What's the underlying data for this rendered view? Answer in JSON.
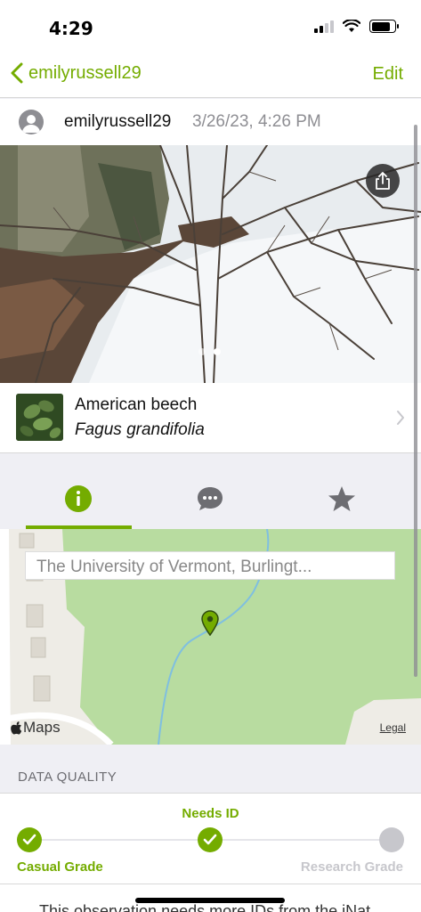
{
  "status": {
    "time": "4:29"
  },
  "nav": {
    "back_label": "emilyrussell29",
    "edit_label": "Edit"
  },
  "observation": {
    "user": "emilyrussell29",
    "date": "3/26/23, 4:26 PM"
  },
  "taxon": {
    "common_name": "American beech",
    "scientific_name": "Fagus grandifolia"
  },
  "tabs": [
    {
      "name": "info",
      "icon": "info-icon",
      "active": true
    },
    {
      "name": "activity",
      "icon": "chat-bubble-icon",
      "active": false
    },
    {
      "name": "favorites",
      "icon": "star-icon",
      "active": false
    }
  ],
  "map": {
    "location": "The University of Vermont, Burlingt...",
    "logo": "Maps",
    "legal": "Legal"
  },
  "data_quality": {
    "header": "DATA QUALITY",
    "needs_id": "Needs ID",
    "casual": "Casual Grade",
    "research": "Research Grade"
  },
  "bottom_text": "This observation needs more IDs from the iNat",
  "colors": {
    "accent": "#74ac00",
    "inactive": "#c7c7cc"
  }
}
